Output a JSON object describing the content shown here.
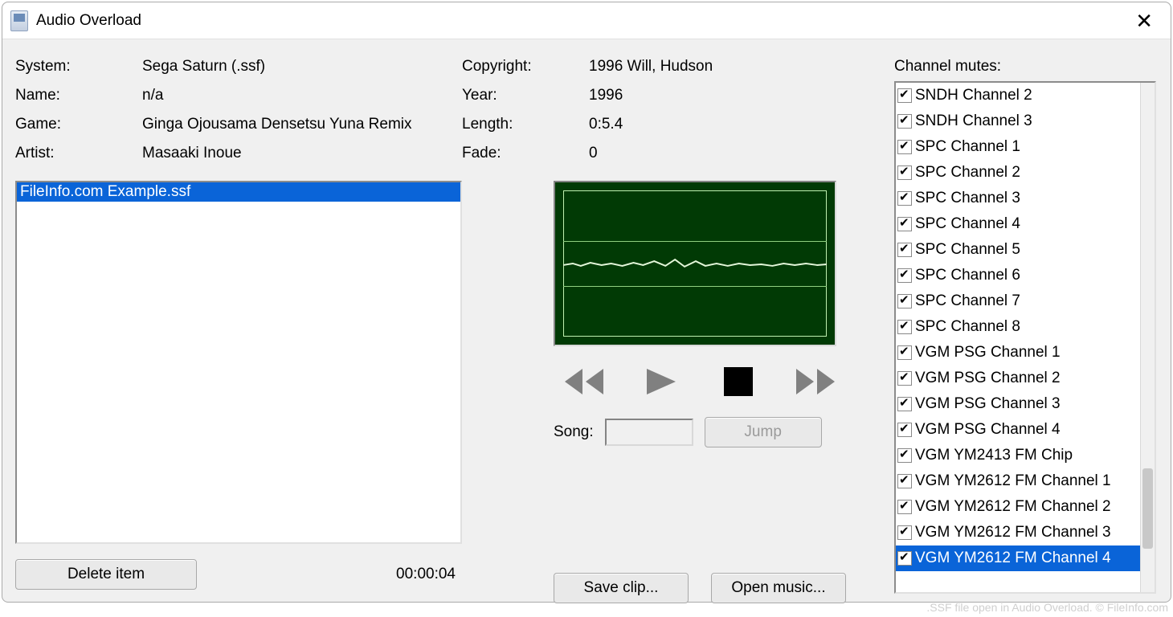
{
  "window": {
    "title": "Audio Overload"
  },
  "meta": {
    "left": [
      {
        "label": "System:",
        "value": "Sega Saturn (.ssf)"
      },
      {
        "label": "Name:",
        "value": "n/a"
      },
      {
        "label": "Game:",
        "value": "Ginga Ojousama Densetsu Yuna Remix"
      },
      {
        "label": "Artist:",
        "value": "Masaaki Inoue"
      }
    ],
    "right": [
      {
        "label": "Copyright:",
        "value": "1996 Will, Hudson"
      },
      {
        "label": "Year:",
        "value": "1996"
      },
      {
        "label": "Length:",
        "value": "0:5.4"
      },
      {
        "label": "Fade:",
        "value": "0"
      }
    ]
  },
  "playlist": {
    "items": [
      "FileInfo.com Example.ssf"
    ],
    "delete_label": "Delete item",
    "elapsed": "00:00:04"
  },
  "transport": {
    "song_label": "Song:",
    "song_value": "",
    "jump_label": "Jump"
  },
  "buttons": {
    "save_clip": "Save clip...",
    "open_music": "Open music..."
  },
  "channels": {
    "title": "Channel mutes:",
    "items": [
      "SNDH Channel 2",
      "SNDH Channel 3",
      "SPC Channel 1",
      "SPC Channel 2",
      "SPC Channel 3",
      "SPC Channel 4",
      "SPC Channel 5",
      "SPC Channel 6",
      "SPC Channel 7",
      "SPC Channel 8",
      "VGM PSG Channel 1",
      "VGM PSG Channel 2",
      "VGM PSG Channel 3",
      "VGM PSG Channel 4",
      "VGM YM2413 FM Chip",
      "VGM YM2612 FM Channel 1",
      "VGM YM2612 FM Channel 2",
      "VGM YM2612 FM Channel 3",
      "VGM YM2612 FM Channel 4"
    ],
    "selected_index": 18
  },
  "footer_credit": ".SSF file open in Audio Overload. © FileInfo.com"
}
